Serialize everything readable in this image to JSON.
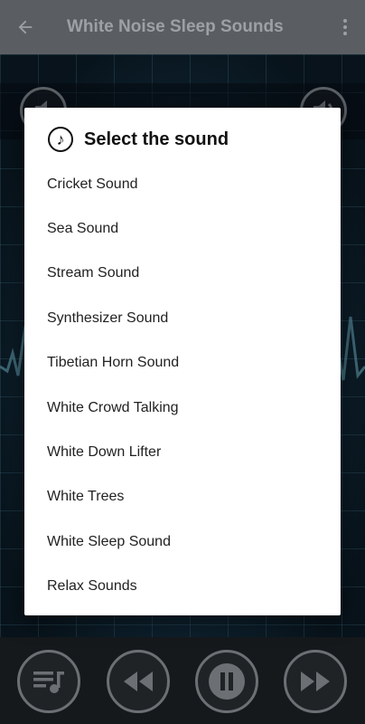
{
  "app_title": "White Noise Sleep Sounds",
  "icons": {
    "back": "arrow-back-icon",
    "more": "more-vert-icon",
    "note": "music-note-icon",
    "playlist": "playlist-icon",
    "rewind": "rewind-icon",
    "pause": "pause-icon",
    "forward": "fast-forward-icon",
    "volume_down": "volume-down-icon",
    "volume_up": "volume-up-icon"
  },
  "dialog": {
    "title": "Select the sound",
    "items": [
      "Cricket Sound",
      "Sea Sound",
      "Stream Sound",
      "Synthesizer Sound",
      "Tibetian Horn Sound",
      "White Crowd Talking",
      "White Down Lifter",
      "White Trees",
      "White Sleep Sound",
      "Relax Sounds"
    ]
  },
  "colors": {
    "appbar": "#5a5e62",
    "dialog_bg": "#ffffff",
    "control_border": "#6c7074"
  }
}
